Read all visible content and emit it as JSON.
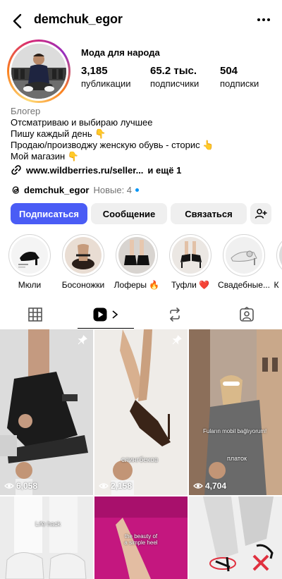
{
  "header": {
    "username": "demchuk_egor"
  },
  "profile": {
    "name": "Мода для народа",
    "stats": [
      {
        "value": "3,185",
        "label": "публикации"
      },
      {
        "value": "65.2 тыс.",
        "label": "подписчики"
      },
      {
        "value": "504",
        "label": "подписки"
      }
    ],
    "category": "Блогер",
    "bio_lines": [
      "Отсматриваю и выбираю лучшее",
      "Пишу каждый день 👇",
      "Продаю/производжу женскую обувь - сторис 👆",
      "Мой магазин 👇"
    ],
    "link": "www.wildberries.ru/seller...",
    "more_links": "и ещё 1",
    "threads_name": "demchuk_egor",
    "threads_new": "Новые: 4"
  },
  "buttons": {
    "follow": "Подписаться",
    "message": "Сообщение",
    "contact": "Связаться"
  },
  "highlights": [
    {
      "label": "Мюли"
    },
    {
      "label": "Босоножки"
    },
    {
      "label": "Лоферы 🔥"
    },
    {
      "label": "Туфли ❤️"
    },
    {
      "label": "Свадебные..."
    },
    {
      "label": "К"
    }
  ],
  "grid": [
    {
      "views": "6,058",
      "pinned": true,
      "caption": ""
    },
    {
      "views": "2,158",
      "pinned": true,
      "caption": "слингбеков"
    },
    {
      "views": "4,704",
      "pinned": false,
      "caption": "платок"
    },
    {
      "views": "",
      "pinned": false,
      "caption": "Life hack"
    },
    {
      "views": "",
      "pinned": false,
      "caption": "the beauty of a simple heel"
    },
    {
      "views": "",
      "pinned": false,
      "caption": ""
    }
  ],
  "grid_extra_text": "Fuların mobil bağlıyorum!",
  "colors": {
    "primary_button": "#4a5cf5",
    "threads_dot": "#0095f6"
  }
}
